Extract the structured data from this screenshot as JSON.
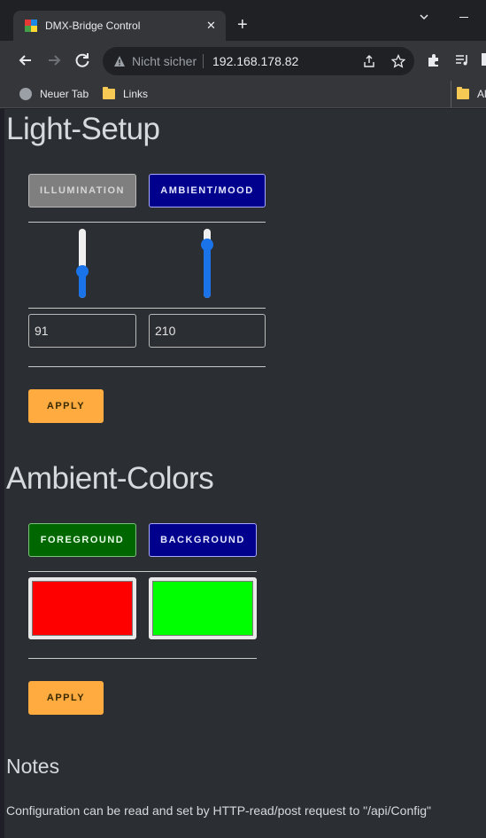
{
  "browser": {
    "tab_title": "DMX-Bridge Control",
    "tab_close": "✕",
    "new_tab": "+",
    "security_label": "Nicht sicher",
    "url": "192.168.178.82",
    "bookmarks": [
      {
        "label": "Neuer Tab",
        "icon": "globe-icon"
      },
      {
        "label": "Links",
        "icon": "folder-icon"
      },
      {
        "label": "Al",
        "icon": "folder-icon"
      }
    ]
  },
  "light_setup": {
    "title": "Light-Setup",
    "illumination_label": "ILLUMINATION",
    "ambient_label": "AMBIENT/MOOD",
    "illumination_value": "91",
    "ambient_value": "210",
    "illumination_level": 91,
    "ambient_level": 210,
    "slider_max": 255,
    "apply_label": "APPLY"
  },
  "ambient_colors": {
    "title": "Ambient-Colors",
    "foreground_label": "FOREGROUND",
    "background_label": "BACKGROUND",
    "foreground_color": "#ff0000",
    "background_color": "#00ff00",
    "apply_label": "APPLY"
  },
  "notes": {
    "title": "Notes",
    "text": "Configuration can be read and set by HTTP-read/post request to \"/api/Config\""
  },
  "colors": {
    "accent_blue": "#1a73e8",
    "apply_orange": "#ffab40",
    "navy": "#00008d",
    "green": "#006600"
  }
}
